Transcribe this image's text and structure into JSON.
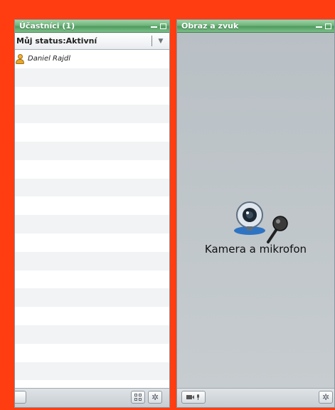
{
  "participants_pane": {
    "title": "Účastníci (1)",
    "status_label": "Můj status:Aktivní",
    "participants": [
      {
        "name": "Daniel Rajdl",
        "icon": "user-icon"
      }
    ],
    "footer_buttons": [
      "grid-view-icon",
      "gear-icon"
    ]
  },
  "av_pane": {
    "title": "Obraz a zvuk",
    "label": "Kamera a mikrofon",
    "icon": "webcam-microphone-icon",
    "footer_buttons": [
      "camera-microphone-icon",
      "gear-icon"
    ]
  },
  "colors": {
    "frame": "#ff3d10",
    "header_green": "#5fa86e",
    "pane_background": "#c3c9cd"
  }
}
